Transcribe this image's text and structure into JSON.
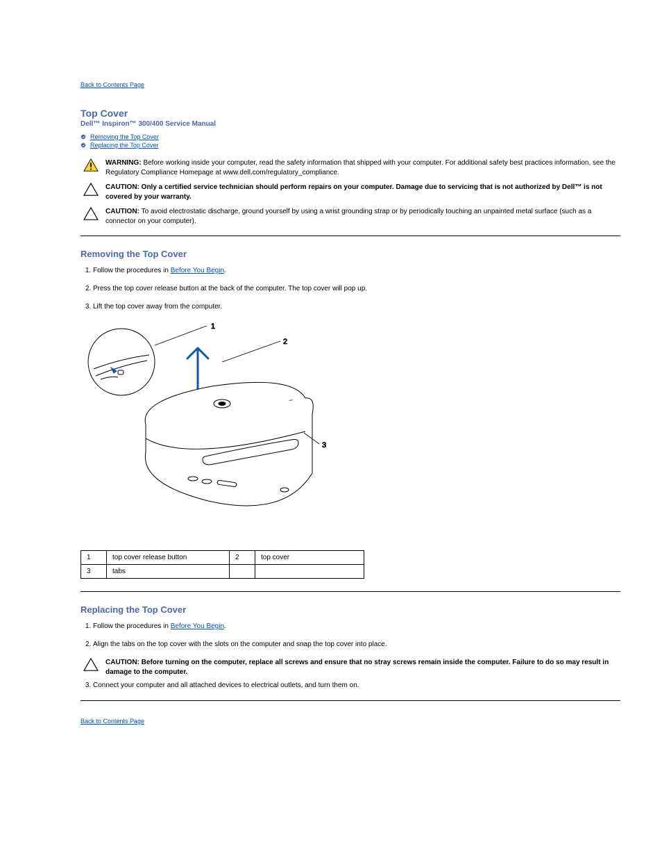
{
  "nav": {
    "back_top": "Back to Contents Page",
    "back_bottom": "Back to Contents Page"
  },
  "header": {
    "title": "Top Cover",
    "subtitle": "Dell™ Inspiron™ 300/400 Service Manual"
  },
  "bullets": [
    "Removing the Top Cover",
    "Replacing the Top Cover"
  ],
  "notices": {
    "warning_label": "WARNING: ",
    "warning_text": "Before working inside your computer, read the safety information that shipped with your computer. For additional safety best practices information, see the Regulatory Compliance Homepage at www.dell.com/regulatory_compliance.",
    "caution1_label": "CAUTION: ",
    "caution1_bold": "Only a certified service technician should perform repairs on your computer. Damage due to servicing that is not authorized by Dell™ is not covered by your warranty.",
    "caution2_label": "CAUTION: ",
    "caution2_text": "To avoid electrostatic discharge, ground yourself by using a wrist grounding strap or by periodically touching an unpainted metal surface (such as a connector on your computer)."
  },
  "section_remove": {
    "title": "Removing the Top Cover",
    "steps_before": [
      {
        "n": "1.",
        "prefix": "Follow the procedures in ",
        "link": "Before You Begin",
        "suffix": "."
      },
      {
        "n": "2.",
        "text": "Press the top cover release button at the back of the computer. The top cover will pop up."
      },
      {
        "n": "3.",
        "text": "Lift the top cover away from the computer."
      }
    ]
  },
  "illustration_callouts": [
    "1",
    "2",
    "3"
  ],
  "parts_table": [
    [
      "1",
      "top cover release button",
      "2",
      "top cover"
    ],
    [
      "3",
      "tabs",
      "",
      ""
    ]
  ],
  "section_replace": {
    "title": "Replacing the Top Cover",
    "steps": [
      {
        "n": "1.",
        "prefix": "Follow the procedures in ",
        "link": "Before You Begin",
        "suffix": "."
      },
      {
        "n": "2.",
        "text": "Align the tabs on the top cover with the slots on the computer and snap the top cover into place."
      }
    ]
  },
  "caution_postwork": {
    "label": "CAUTION: ",
    "text": "Before turning on the computer, replace all screws and ensure that no stray screws remain inside the computer. Failure to do so may result in damage to the computer."
  },
  "final_step": {
    "n": "3.",
    "text": "Connect your computer and all attached devices to electrical outlets, and turn them on."
  }
}
